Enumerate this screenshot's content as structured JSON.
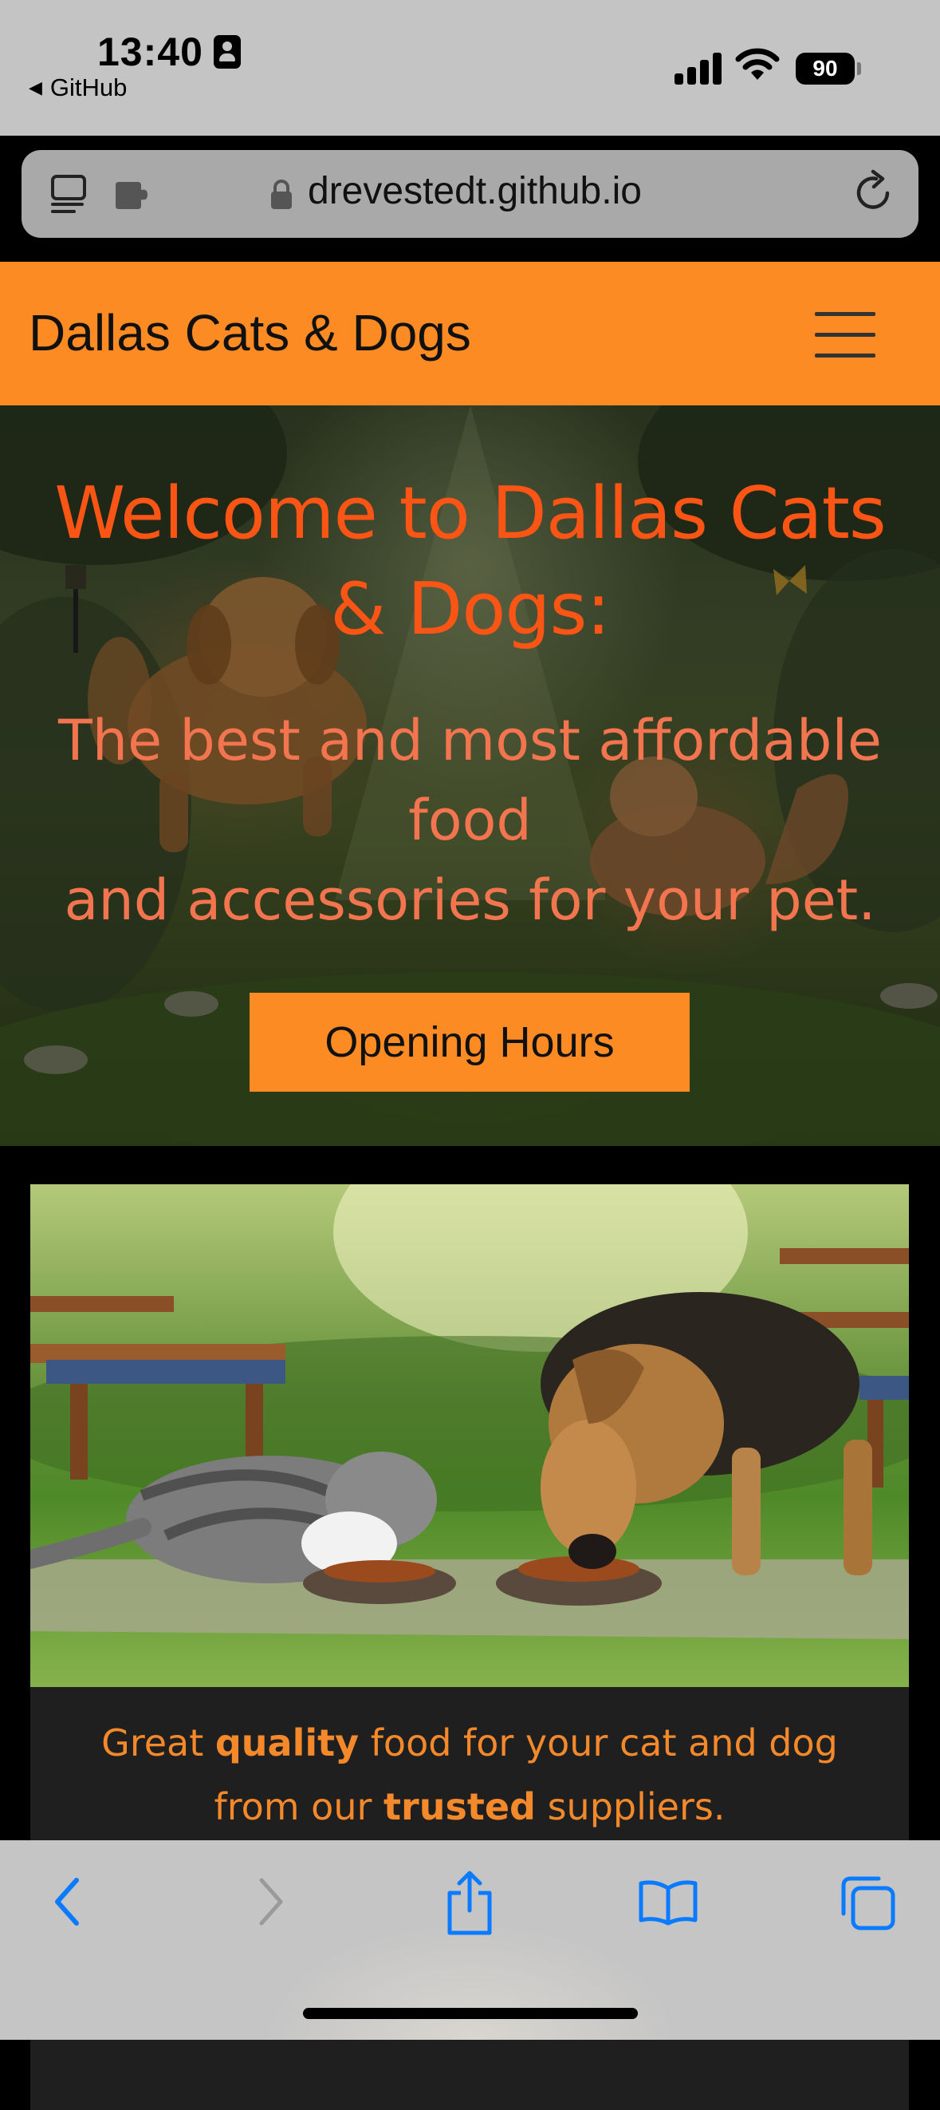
{
  "status_bar": {
    "time": "13:40",
    "back_app": "GitHub",
    "battery": "90"
  },
  "browser": {
    "url": "drevestedt.github.io"
  },
  "navbar": {
    "brand": "Dallas Cats & Dogs"
  },
  "hero": {
    "title": "Welcome to Dallas Cats & Dogs:",
    "subtitle_line1": "The best and most affordable food",
    "subtitle_line2": "and accessories for your pet.",
    "button_label": "Opening Hours"
  },
  "card": {
    "text_part1": "Great ",
    "text_bold1": "quality",
    "text_part2": " food for your cat and dog",
    "text_part3": "from our ",
    "text_bold2": "trusted",
    "text_part4": " suppliers."
  },
  "colors": {
    "nav_orange": "#fd8b24",
    "hero_title": "#fb5516",
    "hero_subtitle": "#f37550",
    "card_text": "#f4892b",
    "ios_blue": "#0a7aff"
  }
}
